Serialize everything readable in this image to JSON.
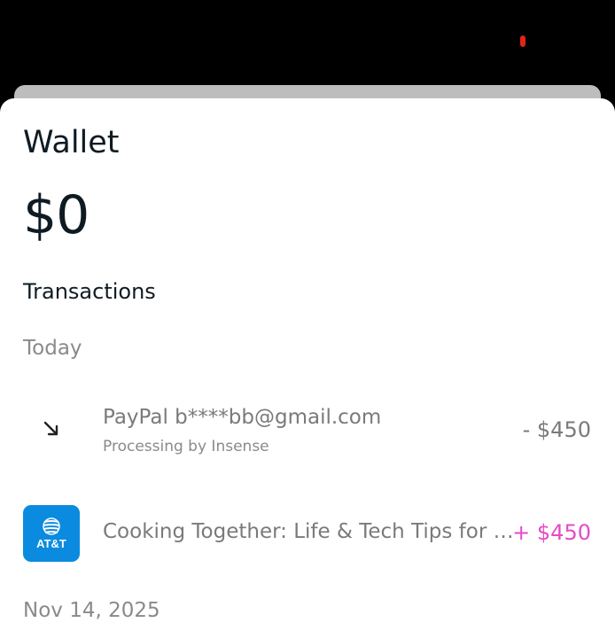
{
  "wallet": {
    "title": "Wallet",
    "balance": "$0"
  },
  "transactions": {
    "heading": "Transactions",
    "groups": [
      {
        "date": "Today",
        "items": [
          {
            "icon": "arrow-down-right-icon",
            "title": "PayPal b****bb@gmail.com",
            "subtitle": "Processing by Insense",
            "amount": "- $450"
          },
          {
            "icon": "att-logo",
            "logo_text": "AT&T",
            "title": "Cooking Together: Life & Tech Tips for Family Fun",
            "amount": "+ $450"
          }
        ]
      },
      {
        "date": "Nov 14, 2025",
        "items": []
      }
    ]
  },
  "colors": {
    "positive_amount": "#e64bc6",
    "att_brand": "#0b8be0"
  }
}
